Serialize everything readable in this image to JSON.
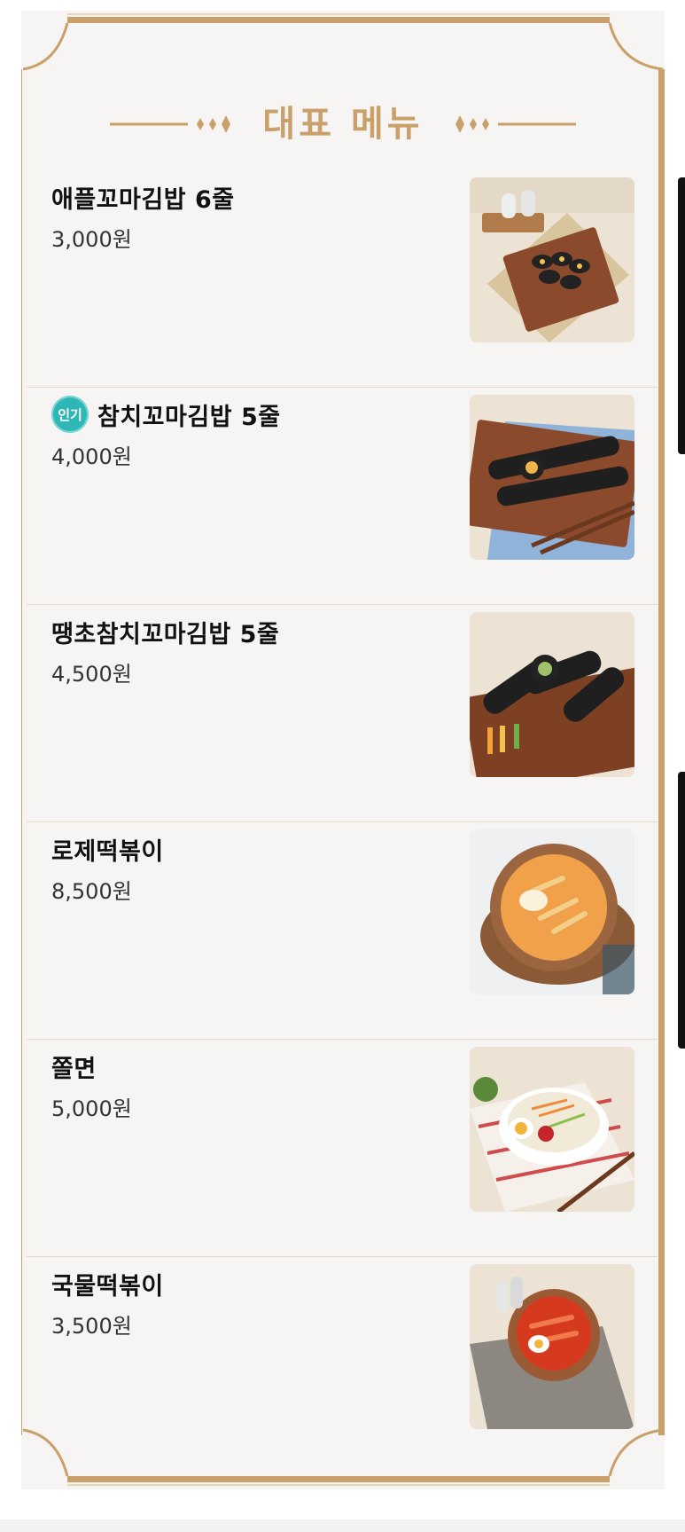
{
  "section": {
    "title": "대표 메뉴"
  },
  "menu": {
    "items": [
      {
        "name": "애플꼬마김밥 6줄",
        "price": "3,000원",
        "badge": "",
        "image": "kimbap-on-board"
      },
      {
        "name": "참치꼬마김밥 5줄",
        "price": "4,000원",
        "badge": "인기",
        "image": "tuna-kimbap-with-chopsticks"
      },
      {
        "name": "땡초참치꼬마김밥 5줄",
        "price": "4,500원",
        "badge": "",
        "image": "spicy-tuna-kimbap"
      },
      {
        "name": "로제떡볶이",
        "price": "8,500원",
        "badge": "",
        "image": "rose-tteokbokki-bowl"
      },
      {
        "name": "쫄면",
        "price": "5,000원",
        "badge": "",
        "image": "jjolmyeon-bowl"
      },
      {
        "name": "국물떡볶이",
        "price": "3,500원",
        "badge": "",
        "image": "soup-tteokbokki-bowl"
      }
    ]
  },
  "colors": {
    "accent_gold": "#c9a069",
    "badge_teal": "#2fb7b7",
    "background": "#f6f5f3"
  }
}
